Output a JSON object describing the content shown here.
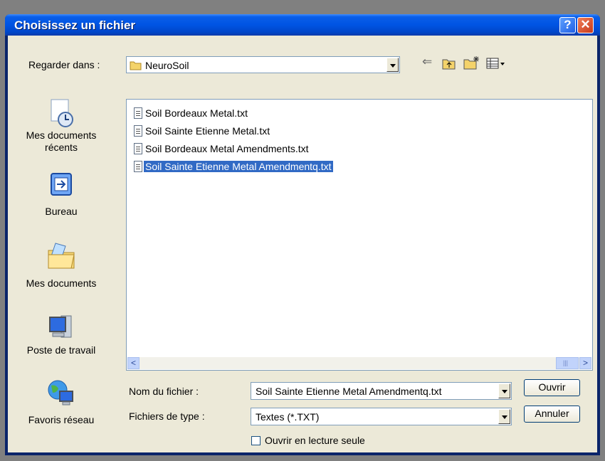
{
  "window": {
    "title": "Choisissez un fichier",
    "help_label": "?",
    "close_label": "✕"
  },
  "look_in": {
    "label": "Regarder dans :",
    "value": "NeuroSoil"
  },
  "toolbar": {
    "back_icon": "back-arrow-icon",
    "up_icon": "up-folder-icon",
    "new_folder_icon": "new-folder-icon",
    "views_icon": "views-menu-icon"
  },
  "places": [
    {
      "label": "Mes documents récents",
      "icon": "recent-documents-icon"
    },
    {
      "label": "Bureau",
      "icon": "desktop-icon"
    },
    {
      "label": "Mes documents",
      "icon": "my-documents-icon"
    },
    {
      "label": "Poste de travail",
      "icon": "my-computer-icon"
    },
    {
      "label": "Favoris réseau",
      "icon": "network-places-icon"
    }
  ],
  "files": [
    {
      "name": "Soil Bordeaux Metal.txt",
      "selected": false
    },
    {
      "name": "Soil Sainte Etienne Metal.txt",
      "selected": false
    },
    {
      "name": "Soil Bordeaux Metal Amendments.txt",
      "selected": false
    },
    {
      "name": "Soil Sainte Etienne Metal Amendmentq.txt",
      "selected": true
    }
  ],
  "filename": {
    "label": "Nom du fichier :",
    "value": "Soil Sainte Etienne Metal Amendmentq.txt"
  },
  "filetype": {
    "label": "Fichiers de type :",
    "value": "Textes (*.TXT)"
  },
  "buttons": {
    "open": "Ouvrir",
    "cancel": "Annuler"
  },
  "readonly": {
    "label": "Ouvrir en lecture seule",
    "checked": false
  },
  "scroll": {
    "left": "<",
    "right": ">",
    "grip": "|||"
  },
  "colors": {
    "titlebar": "#0054e3",
    "selection": "#316ac5",
    "face": "#ece9d8"
  }
}
